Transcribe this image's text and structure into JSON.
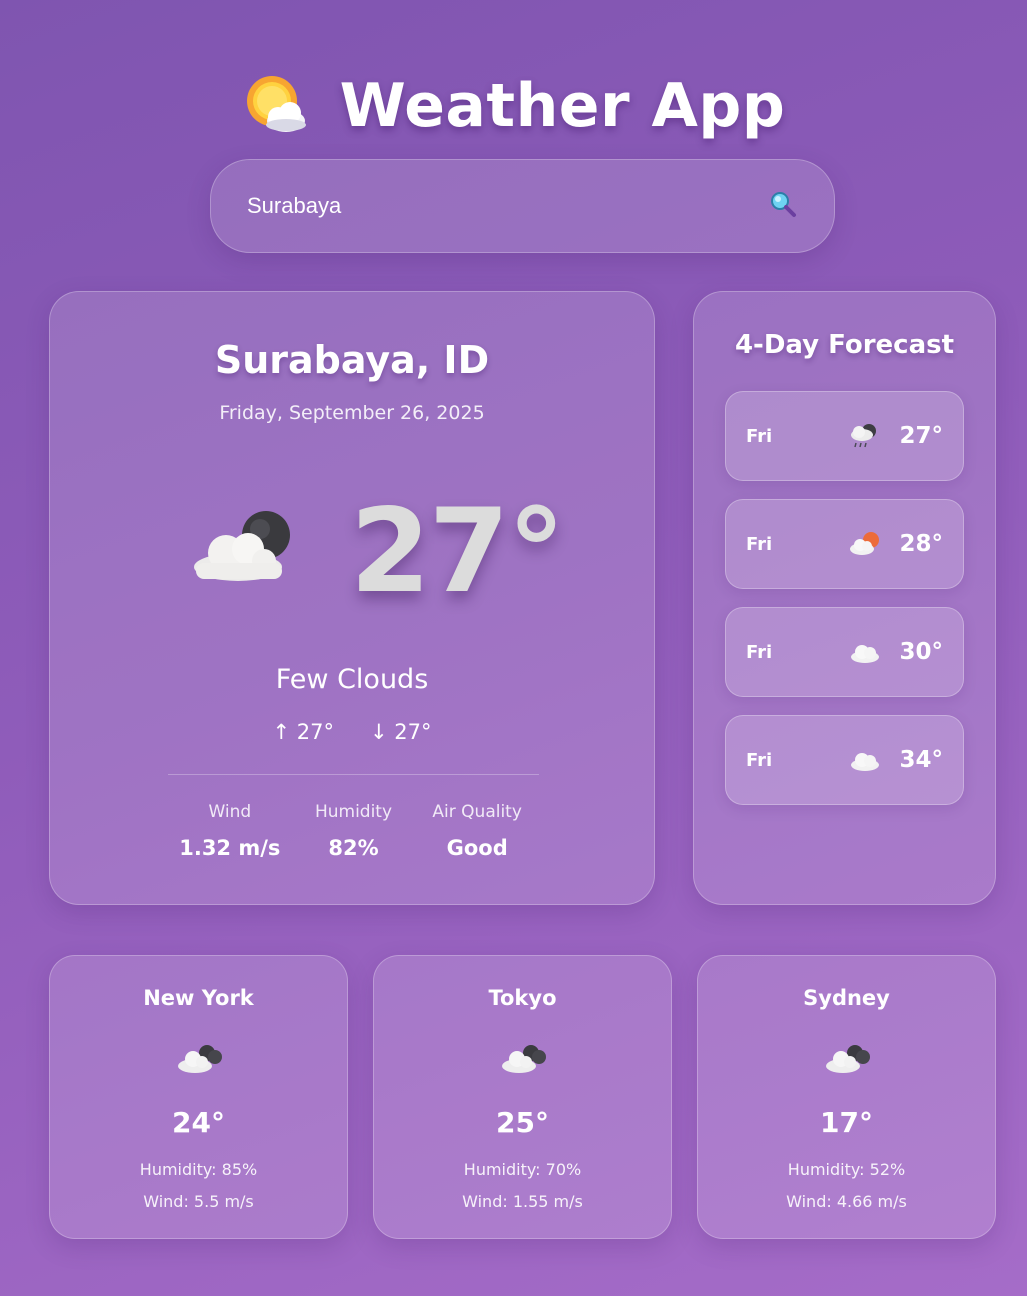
{
  "app": {
    "title": "Weather App",
    "logo_icon": "sun-behind-cloud-icon"
  },
  "search": {
    "value": "Surabaya",
    "placeholder": "",
    "icon": "search-icon"
  },
  "current": {
    "city": "Surabaya, ID",
    "date": "Friday, September 26, 2025",
    "icon": "cloud-dark-moon-icon",
    "temp": "27°",
    "description": "Few Clouds",
    "high": "↑ 27°",
    "low": "↓ 27°",
    "stats": [
      {
        "label": "Wind",
        "value": "1.32 m/s"
      },
      {
        "label": "Humidity",
        "value": "82%"
      },
      {
        "label": "Air Quality",
        "value": "Good"
      }
    ]
  },
  "forecast": {
    "title": "4-Day Forecast",
    "items": [
      {
        "day": "Fri",
        "icon": "rain-cloud-icon",
        "temp": "27°"
      },
      {
        "day": "Fri",
        "icon": "cloud-sun-icon",
        "temp": "28°"
      },
      {
        "day": "Fri",
        "icon": "cloud-icon",
        "temp": "30°"
      },
      {
        "day": "Fri",
        "icon": "cloud-icon",
        "temp": "34°"
      }
    ]
  },
  "cities": [
    {
      "name": "New York",
      "icon": "broken-clouds-icon",
      "temp": "24°",
      "humidity": "Humidity: 85%",
      "wind": "Wind: 5.5 m/s"
    },
    {
      "name": "Tokyo",
      "icon": "broken-clouds-icon",
      "temp": "25°",
      "humidity": "Humidity: 70%",
      "wind": "Wind: 1.55 m/s"
    },
    {
      "name": "Sydney",
      "icon": "broken-clouds-icon",
      "temp": "17°",
      "humidity": "Humidity: 52%",
      "wind": "Wind: 4.66 m/s"
    }
  ],
  "colors": {
    "background_start": "#7f55b0",
    "background_end": "#a56cc8",
    "card_glass": "rgba(255,255,255,0.14)"
  }
}
